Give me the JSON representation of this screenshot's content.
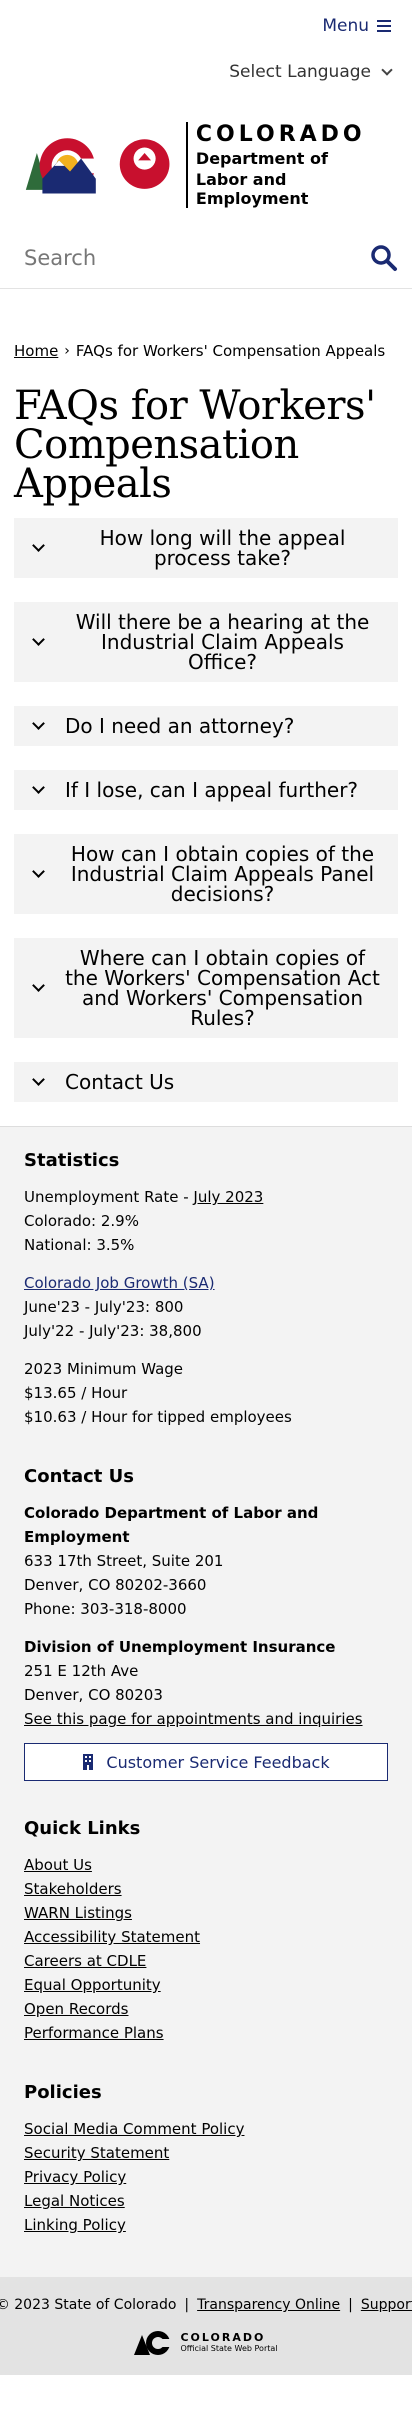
{
  "header": {
    "menu_label": "Menu",
    "language_label": "Select Language",
    "logo": {
      "colorado": "COLORADO",
      "dept_line1": "Department of",
      "dept_line2": "Labor and Employment",
      "badge": "CDLE"
    },
    "search_placeholder": "Search"
  },
  "breadcrumb": {
    "home": "Home",
    "separator": "›",
    "current": "FAQs for Workers' Compensation Appeals"
  },
  "page_title": "FAQs for Workers' Compensation Appeals",
  "faq_items": [
    {
      "label": "How long will the appeal process take?"
    },
    {
      "label": "Will there be a hearing at the Industrial Claim Appeals Office?"
    },
    {
      "label": "Do I need an attorney?"
    },
    {
      "label": "If I lose, can I appeal further?"
    },
    {
      "label": "How can I obtain copies of the Industrial Claim Appeals Panel decisions?"
    },
    {
      "label": "Where can I obtain copies of the Workers' Compensation Act and Workers' Compensation Rules?"
    },
    {
      "label": "Contact Us"
    }
  ],
  "footer": {
    "statistics": {
      "heading": "Statistics",
      "unemployment_prefix": "Unemployment Rate - ",
      "unemployment_link": "July 2023",
      "colorado": "Colorado: 2.9%",
      "national": "National: 3.5%",
      "job_growth_link": "Colorado Job Growth (SA)",
      "growth_line1": "June'23 - July'23: 800",
      "growth_line2": "July'22 - July'23: 38,800",
      "min_wage_title": "2023 Minimum Wage",
      "min_wage_hour": "$13.65 / Hour",
      "min_wage_tipped": "$10.63 / Hour for tipped employees"
    },
    "contact": {
      "heading": "Contact Us",
      "org_name": "Colorado Department of Labor and Employment",
      "address1": "633 17th Street, Suite 201",
      "address2": "Denver, CO  80202-3660",
      "phone": "Phone: 303-318-8000",
      "division_name": "Division of Unemployment Insurance",
      "div_address1": "251 E 12th Ave",
      "div_address2": "Denver, CO  80203",
      "appointments_link": "See this page for appointments and inquiries",
      "feedback_button": "Customer Service Feedback"
    },
    "quick_links": {
      "heading": "Quick Links",
      "items": [
        "About Us",
        "Stakeholders",
        "WARN Listings",
        "Accessibility Statement",
        "Careers at CDLE",
        "Equal Opportunity",
        "Open Records",
        "Performance Plans"
      ]
    },
    "policies": {
      "heading": "Policies",
      "items": [
        "Social Media Comment Policy",
        "Security Statement",
        "Privacy Policy",
        "Legal Notices",
        "Linking Policy"
      ]
    },
    "legal": {
      "copyright": "© 2023 State of Colorado",
      "sep": "|",
      "transparency": "Transparency Online",
      "support": "Support",
      "portal_name": "COLORADO",
      "portal_sub": "Official State Web Portal"
    }
  },
  "colors": {
    "brand_blue": "#1a2a72",
    "footer_bg": "#f3f3f3",
    "accordion_bg": "#f3f3f3"
  }
}
